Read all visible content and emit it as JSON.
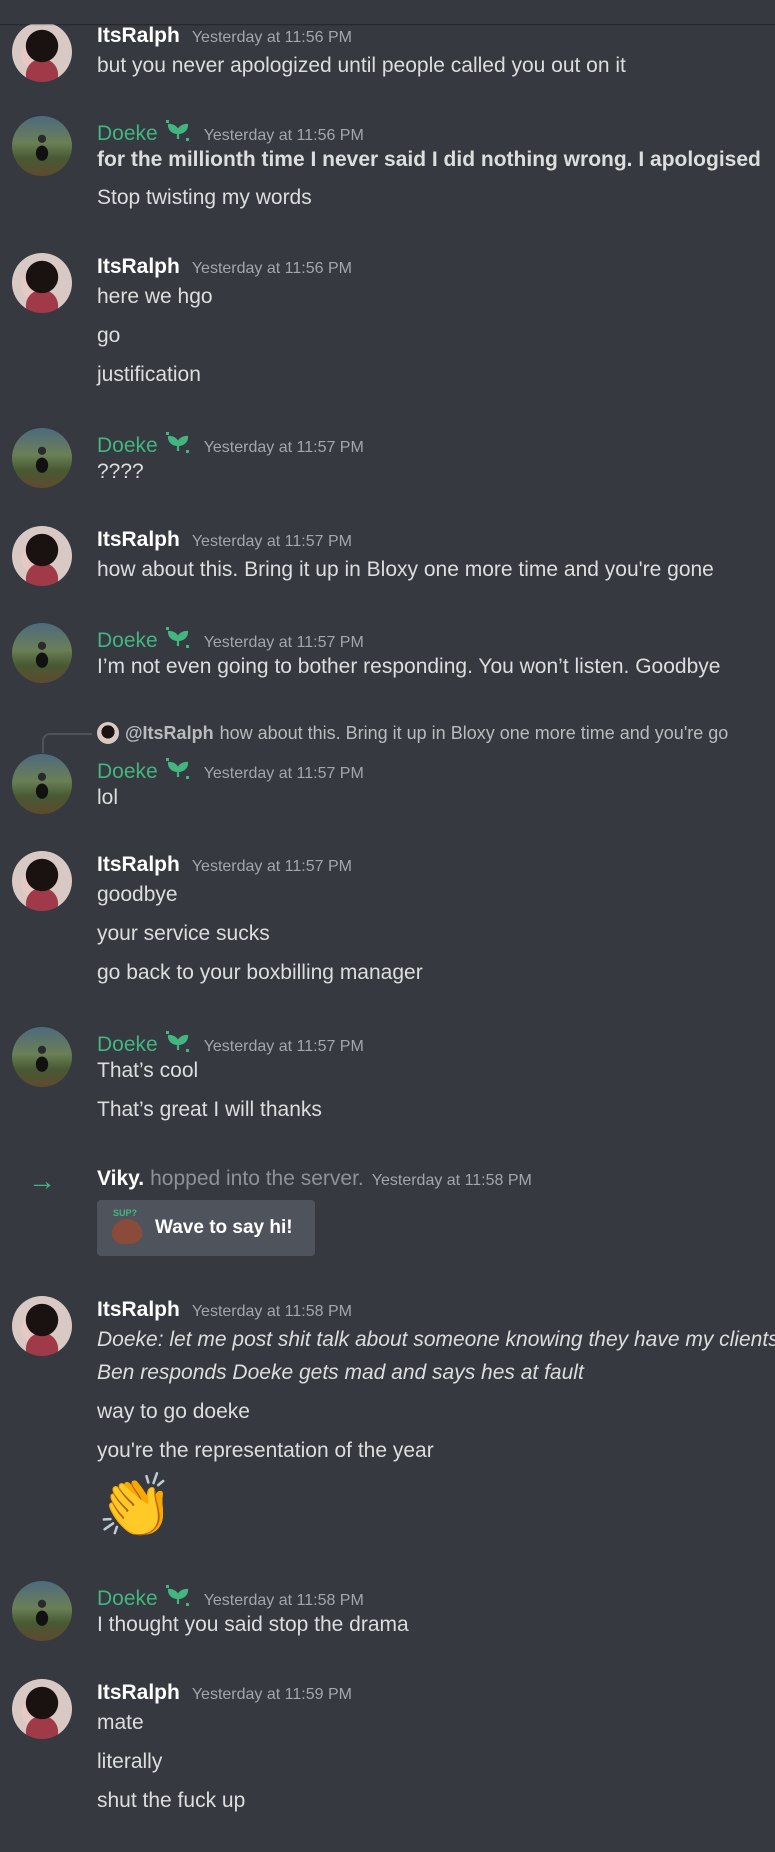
{
  "users": {
    "ralph": "ItsRalph",
    "doeke": "Doeke",
    "viky": "Viky."
  },
  "colors": {
    "background": "#36393f",
    "doeke_role": "#43b581",
    "timestamp": "#a3a6aa",
    "text": "#dcddde"
  },
  "messages": [
    {
      "author": "ItsRalph",
      "time": "Yesterday at 11:56 PM",
      "lines": [
        "but you never apologized until people called you out on it"
      ]
    },
    {
      "author": "Doeke",
      "time": "Yesterday at 11:56 PM",
      "lines": [
        "for the millionth time I never said I did nothing wrong. I apologised",
        "Stop twisting my words"
      ]
    },
    {
      "author": "ItsRalph",
      "time": "Yesterday at 11:56 PM",
      "lines": [
        "here we hgo",
        "go",
        "justification"
      ]
    },
    {
      "author": "Doeke",
      "time": "Yesterday at 11:57 PM",
      "lines": [
        "????"
      ]
    },
    {
      "author": "ItsRalph",
      "time": "Yesterday at 11:57 PM",
      "lines": [
        "how about this. Bring it up in Bloxy one more time and you're gone"
      ]
    },
    {
      "author": "Doeke",
      "time": "Yesterday at 11:57 PM",
      "lines": [
        "I’m not even going to bother responding. You won’t listen. Goodbye"
      ]
    },
    {
      "author": "Doeke",
      "time": "Yesterday at 11:57 PM",
      "reply_to": "@ItsRalph",
      "reply_text": "how about this. Bring it up in Bloxy one more time and you're go",
      "lines": [
        "lol"
      ]
    },
    {
      "author": "ItsRalph",
      "time": "Yesterday at 11:57 PM",
      "lines": [
        "goodbye",
        "your service sucks",
        "go back to your boxbilling manager"
      ]
    },
    {
      "author": "Doeke",
      "time": "Yesterday at 11:57 PM",
      "lines": [
        "That’s cool",
        "That’s great I will thanks"
      ]
    },
    {
      "author": "ItsRalph",
      "time": "Yesterday at 11:58 PM",
      "lines": [
        "Doeke: let me post shit talk about someone knowing they have my clients",
        "Ben responds Doeke gets mad and says hes at fault",
        "way to go doeke",
        "you're the representation of the year"
      ]
    },
    {
      "author": "Doeke",
      "time": "Yesterday at 11:58 PM",
      "lines": [
        "I thought you said stop the drama"
      ]
    },
    {
      "author": "ItsRalph",
      "time": "Yesterday at 11:59 PM",
      "lines": [
        "mate",
        "literally",
        "shut the fuck up"
      ]
    }
  ],
  "join": {
    "user": "Viky.",
    "text": "hopped into the server.",
    "time": "Yesterday at 11:58 PM",
    "wave_label": "Wave to say hi!"
  },
  "clap_emoji": "👏",
  "badge_icon": "leaf-badge-icon"
}
